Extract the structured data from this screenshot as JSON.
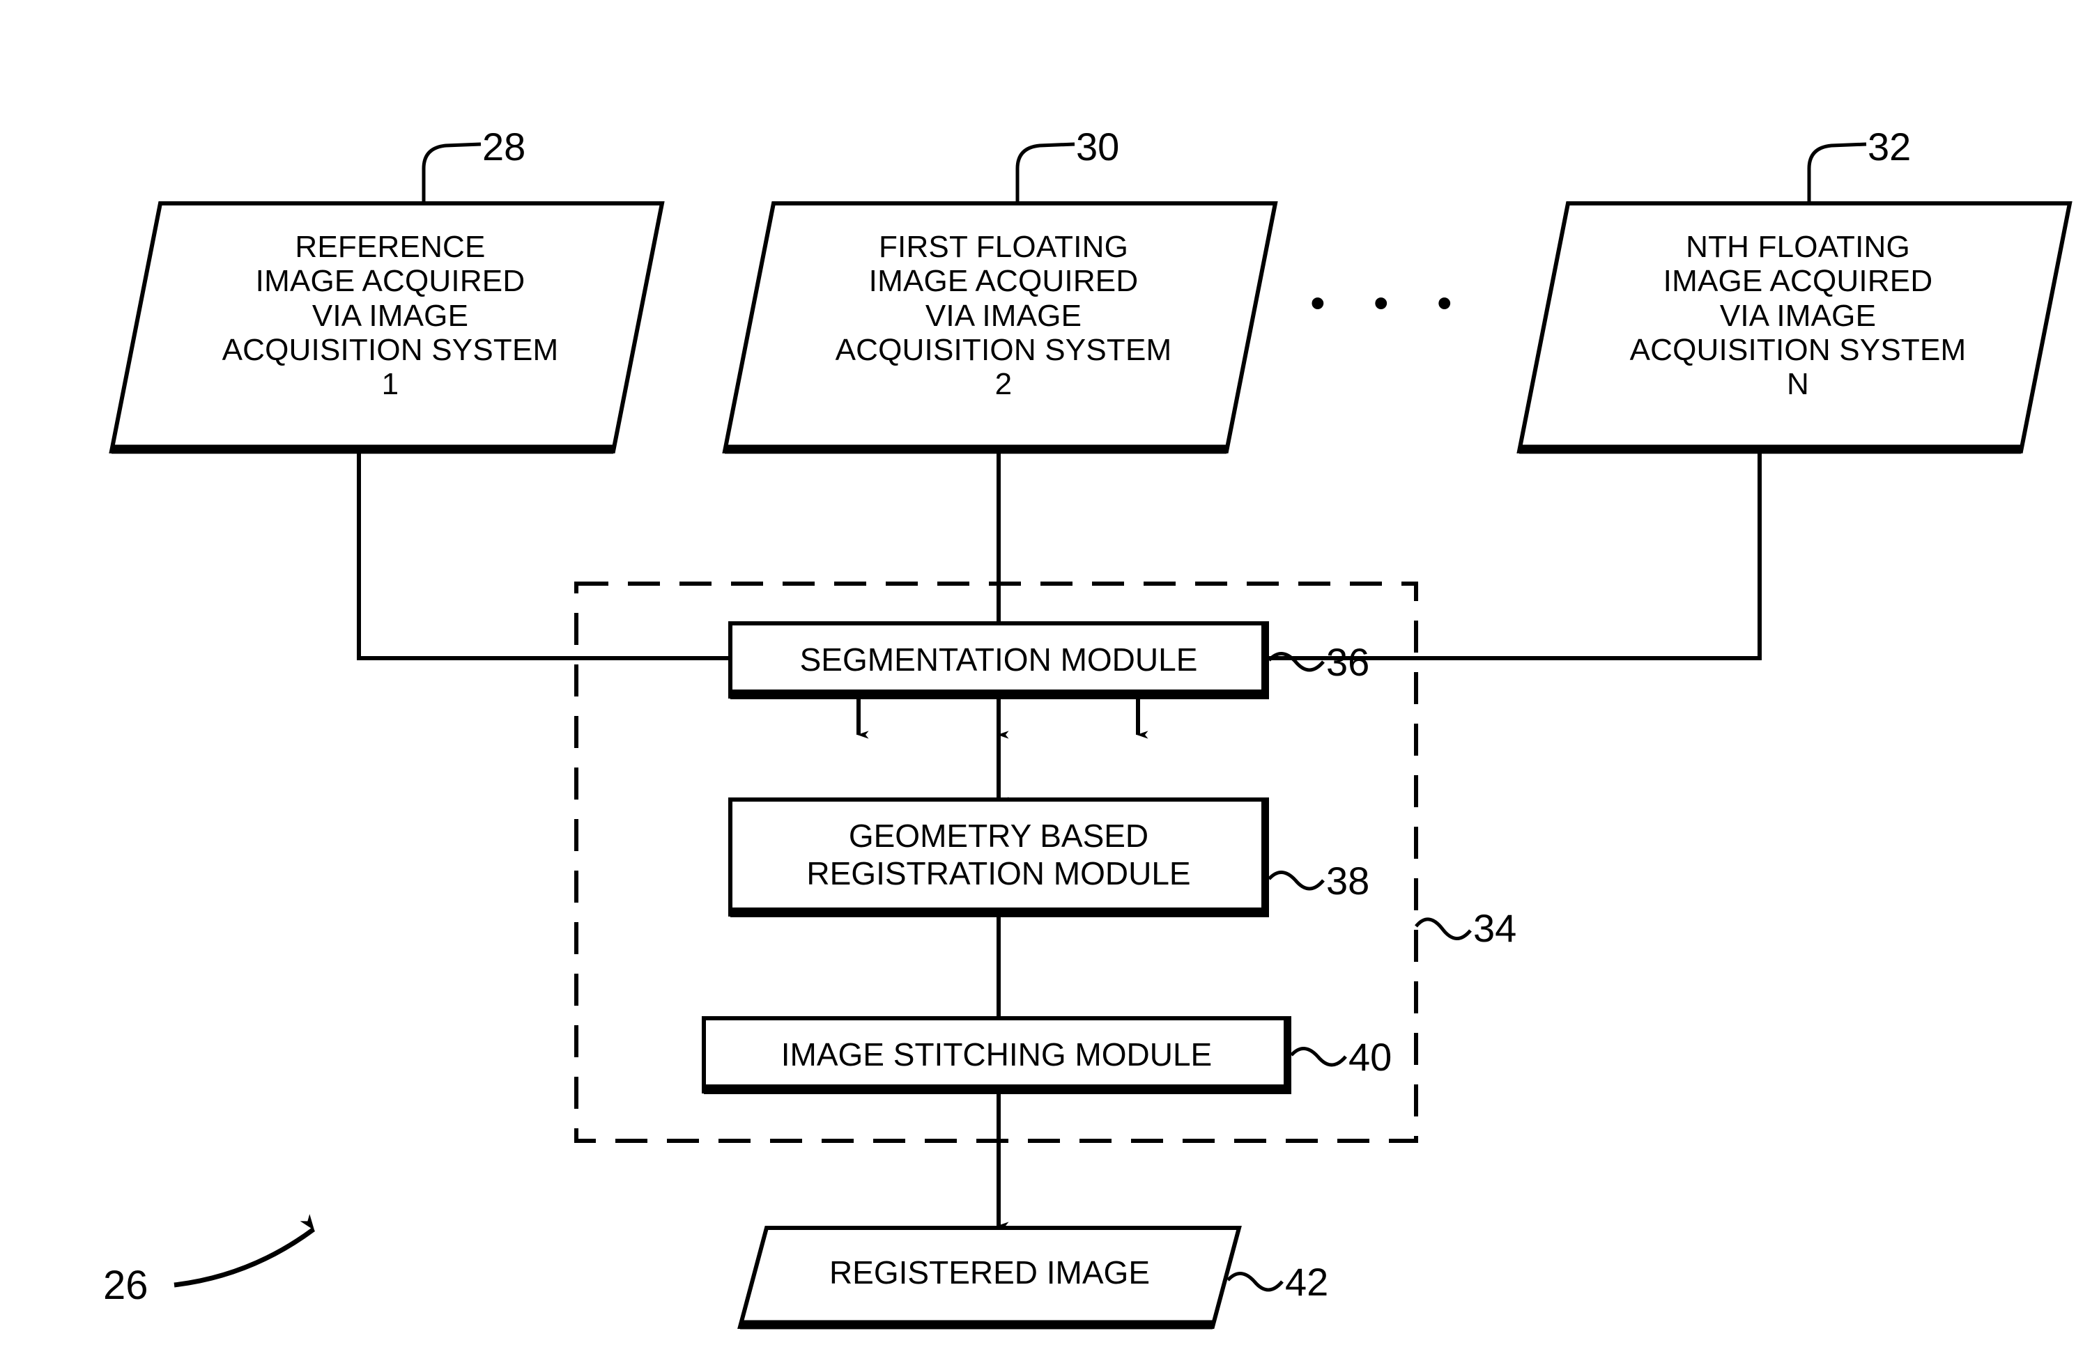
{
  "figure": {
    "figure_ref": "26",
    "ellipsis": "• • •"
  },
  "sources": [
    {
      "ref": "28",
      "text": "REFERENCE\nIMAGE ACQUIRED\nVIA IMAGE\nACQUISITION SYSTEM\n1"
    },
    {
      "ref": "30",
      "text": "FIRST FLOATING\nIMAGE ACQUIRED\nVIA IMAGE\nACQUISITION SYSTEM\n2"
    },
    {
      "ref": "32",
      "text": "NTH FLOATING\nIMAGE ACQUIRED\nVIA IMAGE\nACQUISITION SYSTEM\nN"
    }
  ],
  "container": {
    "ref": "34"
  },
  "modules": [
    {
      "ref": "36",
      "text": "SEGMENTATION MODULE"
    },
    {
      "ref": "38",
      "text": "GEOMETRY BASED\nREGISTRATION MODULE"
    },
    {
      "ref": "40",
      "text": "IMAGE STITCHING MODULE"
    }
  ],
  "output": {
    "ref": "42",
    "text": "REGISTERED IMAGE"
  },
  "colors": {
    "ink": "#000000",
    "paper": "#ffffff"
  }
}
